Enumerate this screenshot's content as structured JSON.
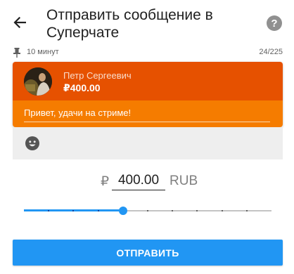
{
  "header": {
    "title": "Отправить сообщение в Суперчате",
    "icons": {
      "back": "arrow-back-icon",
      "help": "help-icon"
    },
    "help_glyph": "?"
  },
  "meta": {
    "duration": "10 минут",
    "char_count": "24/225",
    "icon": "pin-icon"
  },
  "card": {
    "author": "Петр Сергеевич",
    "amount": "₽400.00",
    "message": "Привет, удачи на стриме!",
    "colors": {
      "header": "#e65100",
      "body": "#f57c00"
    }
  },
  "emoji": {
    "icon": "emoji-icon"
  },
  "amount_input": {
    "currency_symbol": "₽",
    "value": "400.00",
    "currency_code": "RUB"
  },
  "slider": {
    "value_fraction": 0.4,
    "steps": 10,
    "accent": "#2196f3"
  },
  "send_button": {
    "label": "ОТПРАВИТЬ",
    "color": "#2196f3"
  }
}
